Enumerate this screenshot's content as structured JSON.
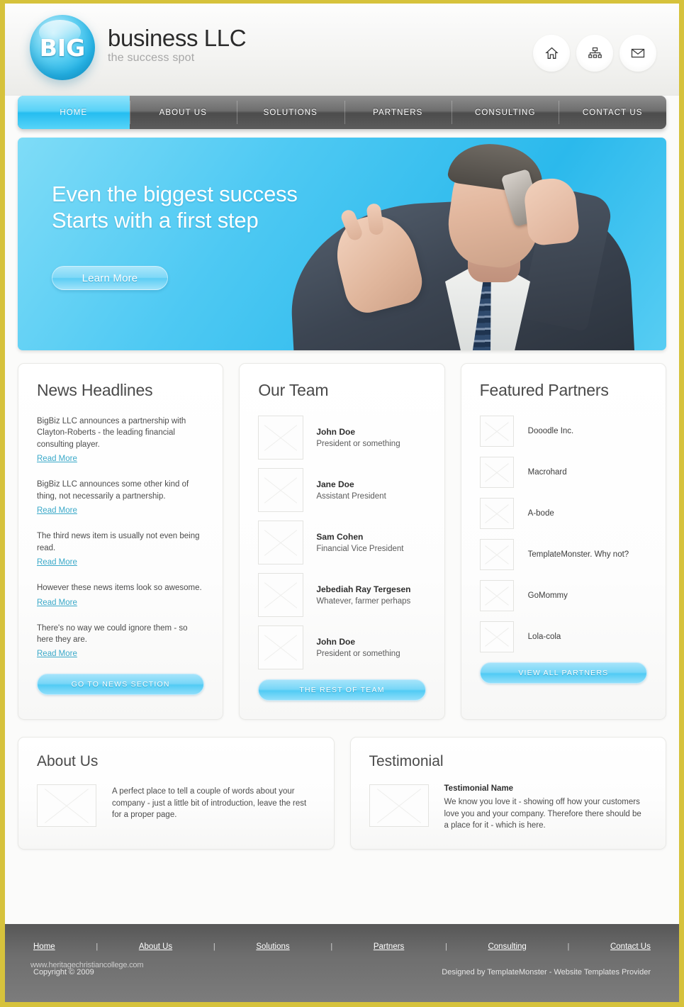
{
  "brand": {
    "orb_text": "BIG",
    "title": "business LLC",
    "tagline": "the success spot"
  },
  "header": {
    "icons": [
      {
        "name": "home-icon",
        "label": "Home"
      },
      {
        "name": "sitemap-icon",
        "label": "Sitemap"
      },
      {
        "name": "mail-icon",
        "label": "Contact"
      }
    ]
  },
  "nav": {
    "items": [
      {
        "label": "HOME",
        "active": true
      },
      {
        "label": "ABOUT US",
        "active": false
      },
      {
        "label": "SOLUTIONS",
        "active": false
      },
      {
        "label": "PARTNERS",
        "active": false
      },
      {
        "label": "CONSULTING",
        "active": false
      },
      {
        "label": "CONTACT US",
        "active": false
      }
    ]
  },
  "hero": {
    "line1": "Even the biggest success",
    "line2": "Starts with a first step",
    "button": "Learn More",
    "image_alt": "businessman-on-phone-photo"
  },
  "news": {
    "heading": "News Headlines",
    "read_more": "Read More",
    "items": [
      {
        "text": "BigBiz LLC announces a partnership with Clayton-Roberts - the leading financial consulting player."
      },
      {
        "text": "BigBiz LLC announces some other kind of thing, not necessarily a partnership."
      },
      {
        "text": "The third news item is usually not even being read."
      },
      {
        "text": "However these news items look so awesome."
      },
      {
        "text": "There's no way  we could ignore them - so here they are."
      }
    ],
    "button": "GO TO NEWS SECTION"
  },
  "team": {
    "heading": "Our Team",
    "members": [
      {
        "name": "John Doe",
        "role": "President or something"
      },
      {
        "name": "Jane Doe",
        "role": "Assistant President"
      },
      {
        "name": "Sam Cohen",
        "role": "Financial Vice President"
      },
      {
        "name": "Jebediah Ray Tergesen",
        "role": "Whatever, farmer perhaps"
      },
      {
        "name": "John Doe",
        "role": "President or something"
      }
    ],
    "button": "THE REST OF TEAM"
  },
  "partners": {
    "heading": "Featured Partners",
    "items": [
      {
        "name": "Dooodle Inc."
      },
      {
        "name": "Macrohard"
      },
      {
        "name": "A-bode"
      },
      {
        "name": "TemplateMonster. Why not?"
      },
      {
        "name": "GoMommy"
      },
      {
        "name": "Lola-cola"
      }
    ],
    "button": "VIEW ALL PARTNERS"
  },
  "about": {
    "heading": "About Us",
    "body": "A perfect place to tell a couple of words about your company - just a little bit of introduction, leave the rest for a proper page."
  },
  "testimonial": {
    "heading": "Testimonial",
    "name": "Testimonial Name",
    "body": "We know you love it - showing off how your customers love you and your company. Therefore there should be a place for it - which is here."
  },
  "footer": {
    "links": [
      "Home",
      "About Us",
      "Solutions",
      "Partners",
      "Consulting",
      "Contact Us"
    ],
    "separator": "|",
    "copyright": "Copyright © 2009",
    "credit": "Designed by TemplateMonster - Website Templates Provider",
    "watermark": "www.heritagechristiancollege.com"
  },
  "colors": {
    "page_border": "#d6c23c",
    "accent_cyan": "#4ec9f3",
    "nav_dark": "#6e6e6e",
    "link_blue": "#3aa9c9",
    "footer_gray": "#6e6e6e"
  }
}
